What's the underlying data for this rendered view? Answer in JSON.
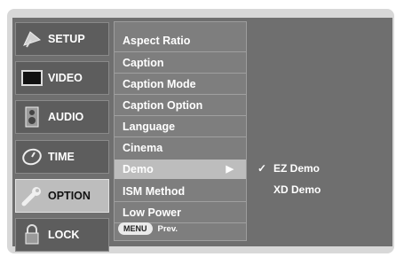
{
  "sidebar": {
    "items": [
      {
        "label": "SETUP",
        "icon": "satellite-dish-icon"
      },
      {
        "label": "VIDEO",
        "icon": "tv-screen-icon"
      },
      {
        "label": "AUDIO",
        "icon": "speaker-icon"
      },
      {
        "label": "TIME",
        "icon": "clock-icon"
      },
      {
        "label": "OPTION",
        "icon": "wrench-icon"
      },
      {
        "label": "LOCK",
        "icon": "padlock-icon"
      }
    ],
    "active": "OPTION"
  },
  "menu": {
    "items": [
      {
        "label": "Aspect Ratio"
      },
      {
        "label": "Caption"
      },
      {
        "label": "Caption Mode"
      },
      {
        "label": "Caption Option"
      },
      {
        "label": "Language"
      },
      {
        "label": "Cinema"
      },
      {
        "label": "Demo",
        "arrow": "▶"
      },
      {
        "label": "ISM Method"
      },
      {
        "label": "Low Power"
      }
    ],
    "highlighted": "Demo",
    "footer": {
      "key_label": "MENU",
      "prev_label": "Prev."
    }
  },
  "submenu": {
    "items": [
      {
        "check": "✓",
        "label": "EZ Demo"
      },
      {
        "check": "",
        "label": "XD Demo"
      }
    ]
  },
  "colors": {
    "panel_bg": "#6f6f6f",
    "menu_bg": "#7e7e7e",
    "highlight": "#bdbdbd",
    "frame_bg": "#d8d8d8"
  }
}
